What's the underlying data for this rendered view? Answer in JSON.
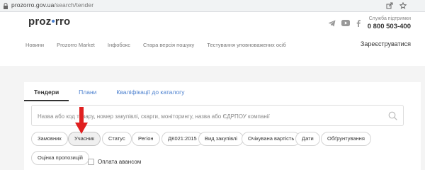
{
  "browser": {
    "url_domain": "prozorro.gov.ua",
    "url_path": "/search/tender"
  },
  "header": {
    "logo_left": "proz",
    "logo_dot": "•",
    "logo_right": "rro",
    "support_label": "Служба підтримки",
    "support_phone": "0 800 503-400",
    "nav": [
      "Новини",
      "Prozorro Market",
      "Інфобокс",
      "Стара версія пошуку",
      "Тестування уповноважених осіб"
    ],
    "register": "Зареєструватися"
  },
  "tabs": [
    "Тендери",
    "Плани",
    "Кваліфікації до каталогу"
  ],
  "search": {
    "placeholder": "Назва або код товару, номер закупівлі, скарги, моніторингу, назва або ЄДРПОУ компанії"
  },
  "filters": [
    "Замовник",
    "Учасник",
    "Статус",
    "Регіон",
    "ДК021:2015",
    "Вид закупівлі",
    "Очікувана вартість",
    "Дати",
    "Обґрунтування",
    "Оцінка пропозицій"
  ],
  "checkbox_label": "Оплата авансом",
  "colors": {
    "accent": "#4a7fce",
    "arrow": "#e02020"
  }
}
